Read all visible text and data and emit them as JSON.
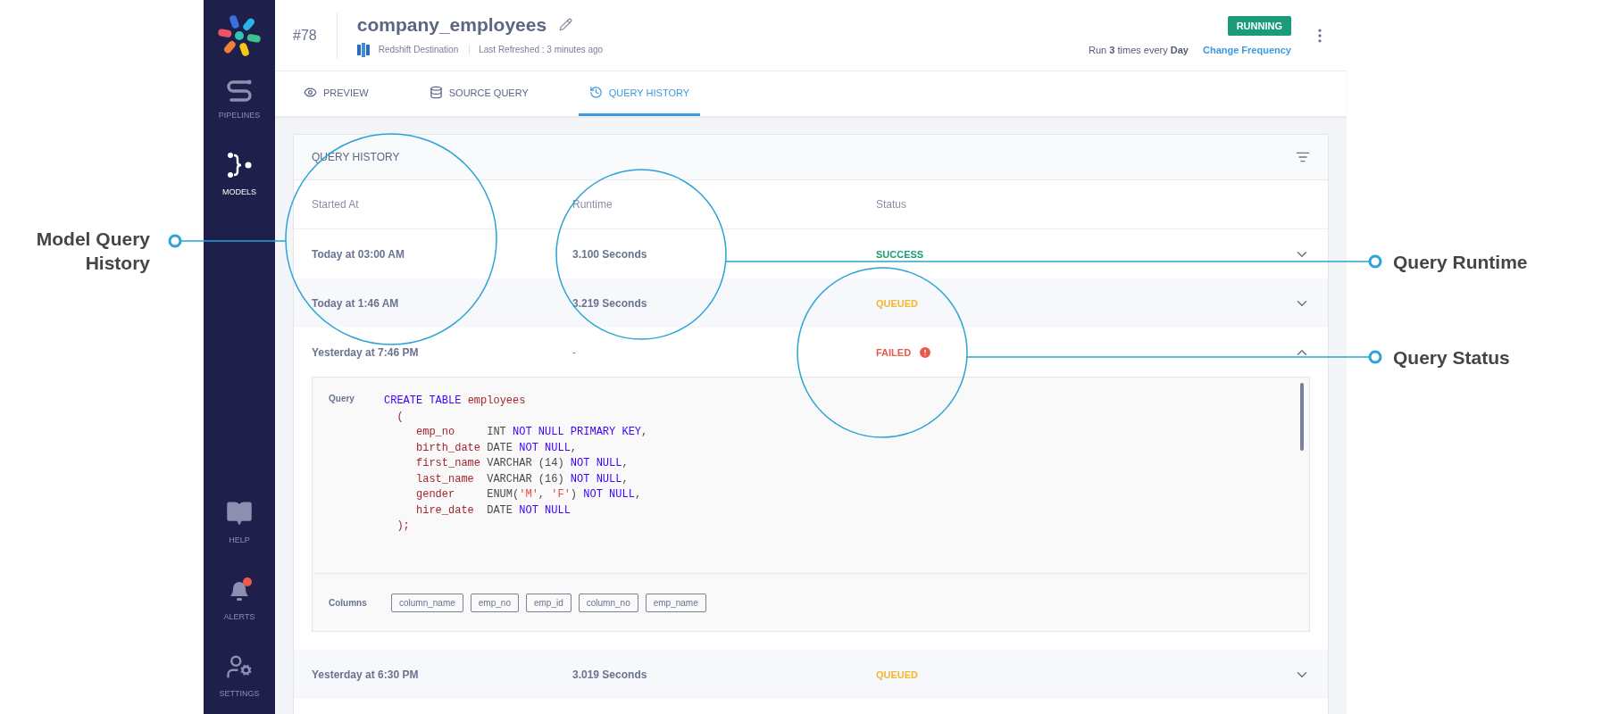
{
  "callouts": [
    {
      "label": "Model Query History"
    },
    {
      "label": "Query Runtime"
    },
    {
      "label": "Query Status"
    }
  ],
  "sidebar": {
    "top_items": [
      {
        "label": "PIPELINES",
        "kind": "pipelines",
        "selected": false
      },
      {
        "label": "MODELS",
        "kind": "models",
        "selected": true
      }
    ],
    "bottom_items": [
      {
        "label": "HELP",
        "kind": "help",
        "selected": false
      },
      {
        "label": "ALERTS",
        "kind": "alerts",
        "selected": false
      },
      {
        "label": "SETTINGS",
        "kind": "settings",
        "selected": false
      }
    ]
  },
  "header": {
    "number": "#78",
    "title": "company_employees",
    "destination": "Redshift Destination",
    "last_refreshed": "Last Refreshed : 3 minutes ago",
    "status": "RUNNING",
    "schedule": "Run **3** times every **Day**",
    "change_link": "Change Frequency"
  },
  "tabs": [
    {
      "label": "PREVIEW",
      "kind": "preview",
      "selected": false
    },
    {
      "label": "SOURCE QUERY",
      "kind": "source",
      "selected": false
    },
    {
      "label": "QUERY HISTORY",
      "kind": "history",
      "selected": true
    }
  ],
  "history": {
    "title": "QUERY HISTORY",
    "columns": [
      "Started At",
      "Runtime",
      "Status"
    ],
    "rows": [
      {
        "started": "Today at 03:00 AM",
        "runtime": "3.100 Seconds",
        "status": "SUCCESS",
        "kind": "success",
        "expanded": false
      },
      {
        "started": "Today at 1:46 AM",
        "runtime": "3.219 Seconds",
        "status": "QUEUED",
        "kind": "queued",
        "expanded": false
      },
      {
        "started": "Yesterday at 7:46 PM",
        "runtime": "-",
        "status": "FAILED",
        "kind": "failed",
        "expanded": true,
        "detail": {
          "query_label": "Query",
          "code": [
            [
              {
                "kind": "keyword",
                "text": "CREATE TABLE "
              },
              {
                "kind": "identifier",
                "text": "employees"
              }
            ],
            [
              {
                "kind": "identifier",
                "text": "  ("
              }
            ],
            [
              {
                "kind": "identifier",
                "text": "     emp_no     "
              },
              {
                "kind": "plain",
                "text": "INT "
              },
              {
                "kind": "keyword",
                "text": "NOT NULL PRIMARY KEY"
              },
              {
                "kind": "plain",
                "text": ","
              }
            ],
            [
              {
                "kind": "identifier",
                "text": "     birth_date "
              },
              {
                "kind": "plain",
                "text": "DATE "
              },
              {
                "kind": "keyword",
                "text": "NOT NULL"
              },
              {
                "kind": "plain",
                "text": ","
              }
            ],
            [
              {
                "kind": "identifier",
                "text": "     first_name "
              },
              {
                "kind": "plain",
                "text": "VARCHAR (14) "
              },
              {
                "kind": "keyword",
                "text": "NOT NULL"
              },
              {
                "kind": "plain",
                "text": ","
              }
            ],
            [
              {
                "kind": "identifier",
                "text": "     last_name  "
              },
              {
                "kind": "plain",
                "text": "VARCHAR (16) "
              },
              {
                "kind": "keyword",
                "text": "NOT NULL"
              },
              {
                "kind": "plain",
                "text": ","
              }
            ],
            [
              {
                "kind": "identifier",
                "text": "     gender     "
              },
              {
                "kind": "plain",
                "text": "ENUM("
              },
              {
                "kind": "string",
                "text": "'M'"
              },
              {
                "kind": "plain",
                "text": ", "
              },
              {
                "kind": "string",
                "text": "'F'"
              },
              {
                "kind": "plain",
                "text": ") "
              },
              {
                "kind": "keyword",
                "text": "NOT NULL"
              },
              {
                "kind": "plain",
                "text": ","
              }
            ],
            [
              {
                "kind": "identifier",
                "text": "     hire_date  "
              },
              {
                "kind": "plain",
                "text": "DATE "
              },
              {
                "kind": "keyword",
                "text": "NOT NULL"
              }
            ],
            [
              {
                "kind": "identifier",
                "text": "  );"
              }
            ]
          ],
          "columns_label": "Columns",
          "column_tags": [
            "column_name",
            "emp_no",
            "emp_id",
            "column_no",
            "emp_name"
          ]
        }
      },
      {
        "started": "Yesterday at 6:30 PM",
        "runtime": "3.019 Seconds",
        "status": "QUEUED",
        "kind": "queued",
        "expanded": false
      }
    ]
  }
}
